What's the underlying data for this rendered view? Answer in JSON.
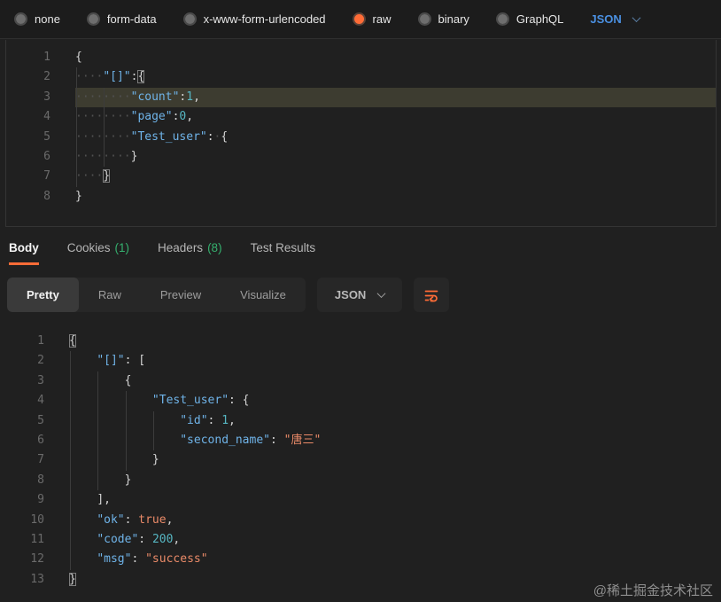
{
  "body_bar": {
    "options": [
      {
        "label": "none",
        "selected": false
      },
      {
        "label": "form-data",
        "selected": false
      },
      {
        "label": "x-www-form-urlencoded",
        "selected": false
      },
      {
        "label": "raw",
        "selected": true
      },
      {
        "label": "binary",
        "selected": false
      },
      {
        "label": "GraphQL",
        "selected": false
      }
    ],
    "language": "JSON"
  },
  "request_editor": {
    "lines": [
      {
        "n": "1",
        "t": [
          [
            "p",
            "{"
          ]
        ]
      },
      {
        "n": "2",
        "t": [
          [
            "gd",
            "0"
          ],
          [
            "wsd",
            "····"
          ],
          [
            "k",
            "\"[]\""
          ],
          [
            "p",
            ":"
          ],
          [
            "bb",
            "{"
          ]
        ]
      },
      {
        "n": "3",
        "hl": true,
        "t": [
          [
            "gd",
            "0"
          ],
          [
            "gd",
            "4"
          ],
          [
            "wsd",
            "········"
          ],
          [
            "k",
            "\"count\""
          ],
          [
            "p",
            ":"
          ],
          [
            "n",
            "1"
          ],
          [
            "p",
            ","
          ]
        ]
      },
      {
        "n": "4",
        "t": [
          [
            "gd",
            "0"
          ],
          [
            "gd",
            "4"
          ],
          [
            "wsd",
            "········"
          ],
          [
            "k",
            "\"page\""
          ],
          [
            "p",
            ":"
          ],
          [
            "n",
            "0"
          ],
          [
            "p",
            ","
          ]
        ]
      },
      {
        "n": "5",
        "t": [
          [
            "gd",
            "0"
          ],
          [
            "gd",
            "4"
          ],
          [
            "wsd",
            "········"
          ],
          [
            "k",
            "\"Test_user\""
          ],
          [
            "p",
            ":"
          ],
          [
            "wsd",
            "·"
          ],
          [
            "p",
            "{"
          ]
        ]
      },
      {
        "n": "6",
        "t": [
          [
            "gd",
            "0"
          ],
          [
            "gd",
            "4"
          ],
          [
            "wsd",
            "········"
          ],
          [
            "p",
            "}"
          ]
        ]
      },
      {
        "n": "7",
        "t": [
          [
            "gd",
            "0"
          ],
          [
            "wsd",
            "····"
          ],
          [
            "bb",
            "}"
          ]
        ]
      },
      {
        "n": "8",
        "t": [
          [
            "p",
            "}"
          ]
        ]
      }
    ]
  },
  "response": {
    "tabs": [
      {
        "label": "Body",
        "active": true
      },
      {
        "label": "Cookies",
        "count": "(1)"
      },
      {
        "label": "Headers",
        "count": "(8)"
      },
      {
        "label": "Test Results"
      }
    ],
    "view_tabs": {
      "options": [
        "Pretty",
        "Raw",
        "Preview",
        "Visualize"
      ],
      "active": "Pretty"
    },
    "format_dropdown": "JSON",
    "wrap_icon": "wrap-text-icon",
    "viewer": {
      "lines": [
        {
          "n": "1",
          "t": [
            [
              "bb",
              "{"
            ]
          ]
        },
        {
          "n": "2",
          "t": [
            [
              "gd",
              "0"
            ],
            [
              "ws",
              "    "
            ],
            [
              "k",
              "\"[]\""
            ],
            [
              "p",
              ": ["
            ]
          ]
        },
        {
          "n": "3",
          "t": [
            [
              "gd",
              "0"
            ],
            [
              "gd",
              "4"
            ],
            [
              "ws",
              "        "
            ],
            [
              "p",
              "{"
            ]
          ]
        },
        {
          "n": "4",
          "t": [
            [
              "gd",
              "0"
            ],
            [
              "gd",
              "4"
            ],
            [
              "gd",
              "8"
            ],
            [
              "ws",
              "            "
            ],
            [
              "k",
              "\"Test_user\""
            ],
            [
              "p",
              ": {"
            ]
          ]
        },
        {
          "n": "5",
          "t": [
            [
              "gd",
              "0"
            ],
            [
              "gd",
              "4"
            ],
            [
              "gd",
              "8"
            ],
            [
              "gd",
              "12"
            ],
            [
              "ws",
              "                "
            ],
            [
              "k",
              "\"id\""
            ],
            [
              "p",
              ": "
            ],
            [
              "n",
              "1"
            ],
            [
              "p",
              ","
            ]
          ]
        },
        {
          "n": "6",
          "t": [
            [
              "gd",
              "0"
            ],
            [
              "gd",
              "4"
            ],
            [
              "gd",
              "8"
            ],
            [
              "gd",
              "12"
            ],
            [
              "ws",
              "                "
            ],
            [
              "k",
              "\"second_name\""
            ],
            [
              "p",
              ": "
            ],
            [
              "s",
              "\"唐三\""
            ]
          ]
        },
        {
          "n": "7",
          "t": [
            [
              "gd",
              "0"
            ],
            [
              "gd",
              "4"
            ],
            [
              "gd",
              "8"
            ],
            [
              "ws",
              "            "
            ],
            [
              "p",
              "}"
            ]
          ]
        },
        {
          "n": "8",
          "t": [
            [
              "gd",
              "0"
            ],
            [
              "gd",
              "4"
            ],
            [
              "ws",
              "        "
            ],
            [
              "p",
              "}"
            ]
          ]
        },
        {
          "n": "9",
          "t": [
            [
              "gd",
              "0"
            ],
            [
              "ws",
              "    "
            ],
            [
              "p",
              "],"
            ]
          ]
        },
        {
          "n": "10",
          "t": [
            [
              "gd",
              "0"
            ],
            [
              "ws",
              "    "
            ],
            [
              "k",
              "\"ok\""
            ],
            [
              "p",
              ": "
            ],
            [
              "b",
              "true"
            ],
            [
              "p",
              ","
            ]
          ]
        },
        {
          "n": "11",
          "t": [
            [
              "gd",
              "0"
            ],
            [
              "ws",
              "    "
            ],
            [
              "k",
              "\"code\""
            ],
            [
              "p",
              ": "
            ],
            [
              "n",
              "200"
            ],
            [
              "p",
              ","
            ]
          ]
        },
        {
          "n": "12",
          "t": [
            [
              "gd",
              "0"
            ],
            [
              "ws",
              "    "
            ],
            [
              "k",
              "\"msg\""
            ],
            [
              "p",
              ": "
            ],
            [
              "s",
              "\"success\""
            ]
          ]
        },
        {
          "n": "13",
          "t": [
            [
              "bb",
              "}"
            ]
          ]
        }
      ]
    }
  },
  "watermark": "@稀土掘金技术社区",
  "colors": {
    "accent_orange": "#ff6c37",
    "count_green": "#35b06e",
    "link_blue": "#4a90e2",
    "json_key": "#6fb3e8",
    "json_number": "#56b6c2",
    "json_string": "#ea8a68",
    "line_highlight": "#3d3c30",
    "background": "#202020",
    "topbar_background": "#1c1c1c"
  }
}
